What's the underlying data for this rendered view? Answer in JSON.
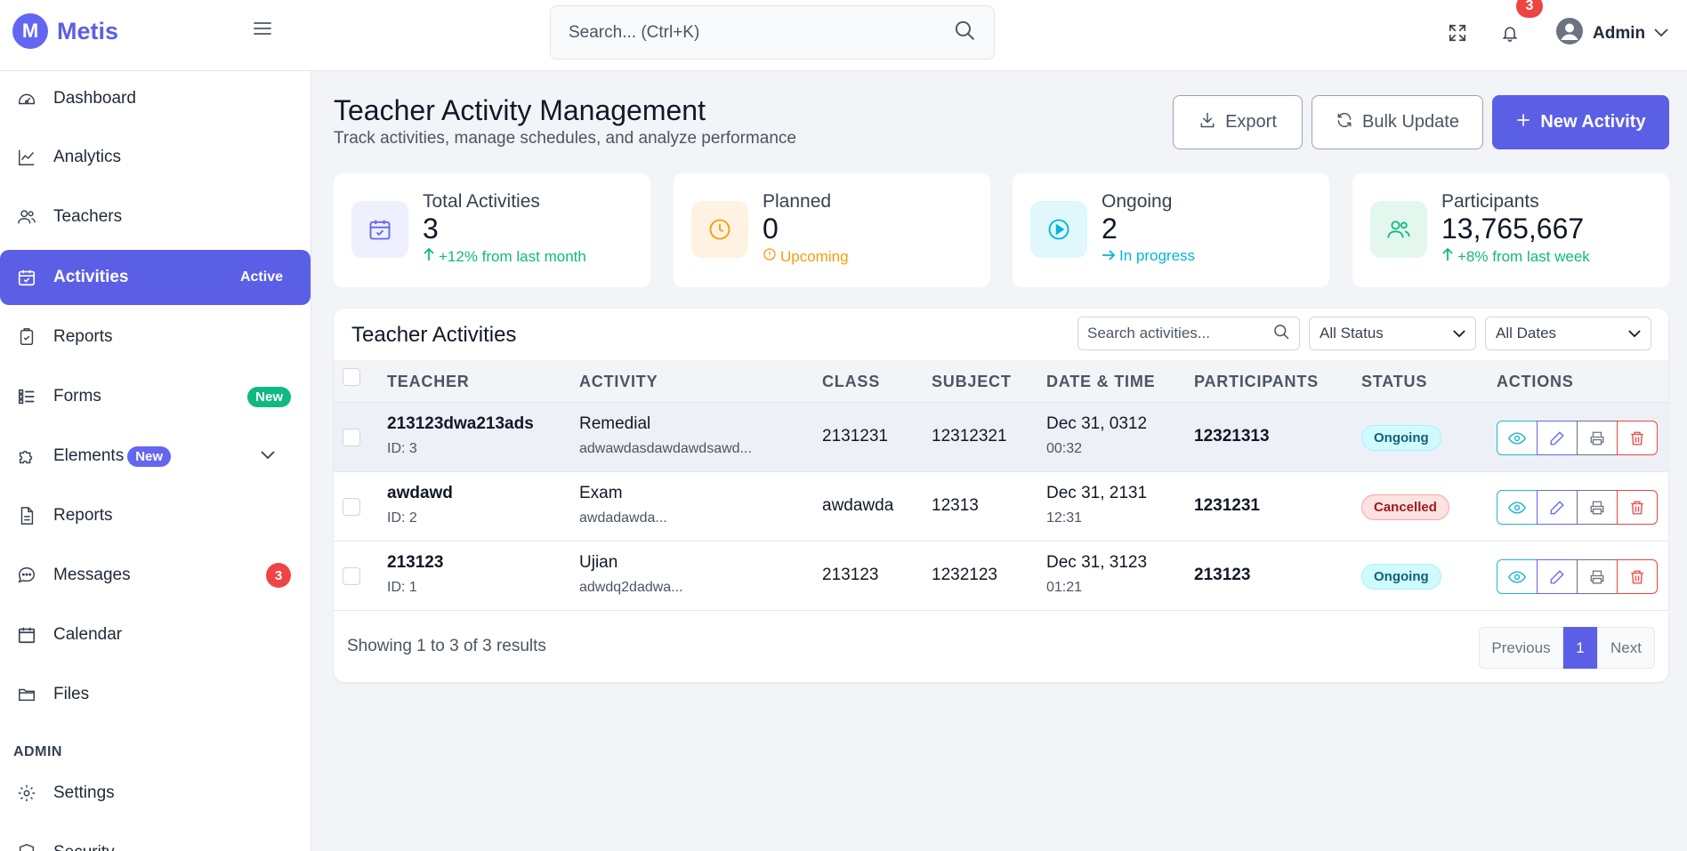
{
  "header": {
    "logo_letter": "M",
    "app_name": "Metis",
    "search_placeholder": "Search... (Ctrl+K)",
    "notification_count": "3",
    "user_name": "Admin"
  },
  "sidebar": {
    "items": [
      {
        "label": "Dashboard",
        "icon": "dashboard-icon"
      },
      {
        "label": "Analytics",
        "icon": "chart-line-icon"
      },
      {
        "label": "Teachers",
        "icon": "users-icon"
      },
      {
        "label": "Activities",
        "icon": "calendar-check-icon",
        "badge": "Active"
      },
      {
        "label": "Reports",
        "icon": "clipboard-icon"
      },
      {
        "label": "Forms",
        "icon": "list-icon",
        "badge": "New"
      },
      {
        "label": "Elements",
        "icon": "puzzle-icon",
        "badge": "New"
      },
      {
        "label": "Reports",
        "icon": "document-icon"
      },
      {
        "label": "Messages",
        "icon": "chat-icon",
        "badge": "3"
      },
      {
        "label": "Calendar",
        "icon": "calendar-icon"
      },
      {
        "label": "Files",
        "icon": "folder-icon"
      }
    ],
    "section_admin": "ADMIN",
    "admin_items": [
      {
        "label": "Settings",
        "icon": "gear-icon"
      },
      {
        "label": "Security",
        "icon": "shield-icon"
      }
    ]
  },
  "page": {
    "title": "Teacher Activity Management",
    "subtitle": "Track activities, manage schedules, and analyze performance",
    "export_label": "Export",
    "bulk_update_label": "Bulk Update",
    "new_activity_label": "New Activity"
  },
  "stats": [
    {
      "label": "Total Activities",
      "value": "3",
      "trend": "+12% from last month",
      "trend_color": "#10b981",
      "icon_bg": "#eef0fd",
      "icon_color": "#6366f1"
    },
    {
      "label": "Planned",
      "value": "0",
      "trend": "Upcoming",
      "trend_color": "#f59e0b",
      "icon_bg": "#fef3e2",
      "icon_color": "#f59e0b"
    },
    {
      "label": "Ongoing",
      "value": "2",
      "trend": "In progress",
      "trend_color": "#06b6d4",
      "icon_bg": "#e0f7fb",
      "icon_color": "#06b6d4"
    },
    {
      "label": "Participants",
      "value": "13,765,667",
      "trend": "+8% from last week",
      "trend_color": "#10b981",
      "icon_bg": "#e4f7ef",
      "icon_color": "#10b981"
    }
  ],
  "table": {
    "title": "Teacher Activities",
    "search_placeholder": "Search activities...",
    "status_filter": "All Status",
    "date_filter": "All Dates",
    "columns": [
      "TEACHER",
      "ACTIVITY",
      "CLASS",
      "SUBJECT",
      "DATE & TIME",
      "PARTICIPANTS",
      "STATUS",
      "ACTIONS"
    ],
    "rows": [
      {
        "teacher": "213123dwa213ads",
        "teacher_id": "ID: 3",
        "activity": "Remedial",
        "activity_desc": "adwawdasdawdawdsawd...",
        "class": "2131231",
        "subject": "12312321",
        "date": "Dec 31, 0312",
        "time": "00:32",
        "participants": "12321313",
        "status": "Ongoing"
      },
      {
        "teacher": "awdawd",
        "teacher_id": "ID: 2",
        "activity": "Exam",
        "activity_desc": "awdadawda...",
        "class": "awdawda",
        "subject": "12313",
        "date": "Dec 31, 2131",
        "time": "12:31",
        "participants": "1231231",
        "status": "Cancelled"
      },
      {
        "teacher": "213123",
        "teacher_id": "ID: 1",
        "activity": "Ujian",
        "activity_desc": "adwdq2dadwa...",
        "class": "213123",
        "subject": "1232123",
        "date": "Dec 31, 3123",
        "time": "01:21",
        "participants": "213123",
        "status": "Ongoing"
      }
    ],
    "footer_text": "Showing 1 to 3 of 3 results",
    "pagination": {
      "prev": "Previous",
      "current": "1",
      "next": "Next"
    }
  },
  "colors": {
    "accent": "#5b5fe6",
    "danger": "#ef4444",
    "success": "#10b981"
  }
}
